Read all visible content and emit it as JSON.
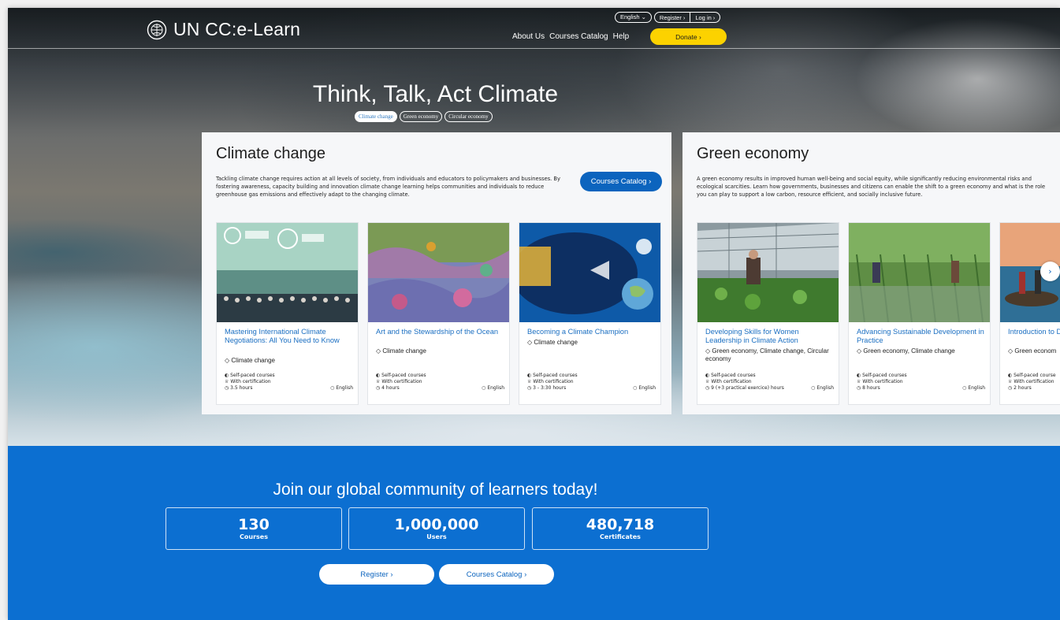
{
  "header": {
    "logo_text": "UN CC:e-Learn",
    "language": "English",
    "register": "Register",
    "login": "Log in",
    "nav": [
      "About Us",
      "Courses Catalog",
      "Help"
    ],
    "donate": "Donate"
  },
  "hero": {
    "title": "Think, Talk, Act Climate",
    "chips": [
      "Climate change",
      "Green economy",
      "Circular economy"
    ]
  },
  "panels": [
    {
      "title": "Climate change",
      "description": "Tackling climate change requires action at all levels of society, from individuals and educators to policymakers and businesses. By fostering awareness, capacity building and innovation climate change learning helps communities and individuals to reduce greenhouse gas emissions and effectively adapt to the changing climate.",
      "button": "Courses Catalog",
      "cards": [
        {
          "title": "Mastering International Climate Negotiations: All You Need to Know",
          "tag": "Climate change",
          "pace": "Self-paced courses",
          "cert": "With certification",
          "duration": "3.5 hours",
          "lang": "English"
        },
        {
          "title": "Art and the Stewardship of the Ocean",
          "tag": "Climate change",
          "pace": "Self-paced courses",
          "cert": "With certification",
          "duration": "4 hours",
          "lang": "English"
        },
        {
          "title": "Becoming a Climate Champion",
          "tag": "Climate change",
          "pace": "Self-paced courses",
          "cert": "With certification",
          "duration": "3 - 3:30 hours",
          "lang": "English"
        }
      ]
    },
    {
      "title": "Green economy",
      "description": "A green economy results in improved human well-being and social equity, while significantly reducing environmental risks and ecological scarcities. Learn how governments, businesses and citizens can enable the shift to a green economy and what is the role you can play to support a low carbon, resource efficient, and socially inclusive future.",
      "cards": [
        {
          "title": "Developing Skills for Women Leadership in Climate Action",
          "tag": "Green economy, Climate change, Circular economy",
          "pace": "Self-paced courses",
          "cert": "With certification",
          "duration": "9 (+3 practical exercice) hours",
          "lang": "English"
        },
        {
          "title": "Advancing Sustainable Development in Practice",
          "tag": "Green economy, Climate change",
          "pace": "Self-paced courses",
          "cert": "With certification",
          "duration": "8 hours",
          "lang": "English"
        },
        {
          "title": "Introduction to Development",
          "tag": "Green econom",
          "pace": "Self-paced course",
          "cert": "With certification",
          "duration": "2 hours",
          "lang": ""
        }
      ]
    }
  ],
  "community": {
    "title": "Join our global community of learners today!",
    "stats": [
      {
        "value": "130",
        "label": "Courses"
      },
      {
        "value": "1,000,000",
        "label": "Users"
      },
      {
        "value": "480,718",
        "label": "Certificates"
      }
    ],
    "register": "Register",
    "catalog": "Courses Catalog"
  }
}
